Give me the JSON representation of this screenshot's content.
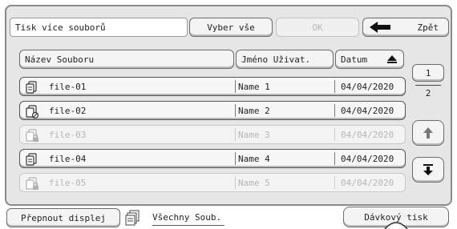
{
  "header": {
    "title": "Tisk více souborů",
    "select_all": "Vyber vše",
    "ok": "OK",
    "back": "Zpět"
  },
  "columns": {
    "name": "Název Souboru",
    "user": "Jméno Uživat.",
    "date": "Datum"
  },
  "files": [
    {
      "name": "file-01",
      "user": "Name 1",
      "date": "04/04/2020",
      "icon": "file-icon",
      "enabled": true
    },
    {
      "name": "file-02",
      "user": "Name 2",
      "date": "04/04/2020",
      "icon": "file-no-print-icon",
      "enabled": true
    },
    {
      "name": "file-03",
      "user": "Name 3",
      "date": "04/04/2020",
      "icon": "file-locked-icon",
      "enabled": false
    },
    {
      "name": "file-04",
      "user": "Name 4",
      "date": "04/04/2020",
      "icon": "file-icon",
      "enabled": true
    },
    {
      "name": "file-05",
      "user": "Name 5",
      "date": "04/04/2020",
      "icon": "file-locked-icon",
      "enabled": false
    }
  ],
  "pager": {
    "current": "1",
    "total": "2"
  },
  "footer": {
    "switch_display": "Přepnout displej",
    "all_files": "Všechny Soub.",
    "batch_print": "Dávkový tisk"
  }
}
